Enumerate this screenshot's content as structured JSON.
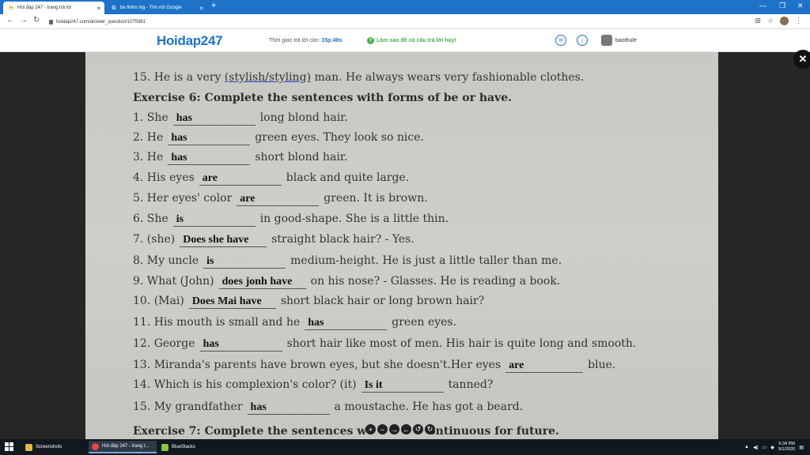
{
  "browser": {
    "tabs": [
      {
        "label": "Hỏi đáp 247 - trang trả lời",
        "active": true
      },
      {
        "label": "be thêm ing - Tìm với Google",
        "active": false
      }
    ],
    "url": "hoidap247.com/answer_question/1075981"
  },
  "site": {
    "logo": "Hoidap247",
    "timer_label": "Thời gian trả lời còn:",
    "timer_value": "15p:48s",
    "howto": "Làm sao để có câu trả lời hay!",
    "username": "baothule"
  },
  "worksheet": {
    "line15": {
      "pre": "15. He is a very ",
      "choice": "(stylish/styling)",
      "post": " man. He always wears very fashionable clothes."
    },
    "title6": "Exercise 6: Complete the sentences with forms of be or have.",
    "items": [
      {
        "pre": "1.  She",
        "answer": "has",
        "post": "long blond hair."
      },
      {
        "pre": "2.  He",
        "answer": "has",
        "post": "green eyes. They look so nice."
      },
      {
        "pre": "3.  He",
        "answer": "has",
        "post": "short blond hair."
      },
      {
        "pre": "4.  His eyes",
        "answer": "are",
        "post": "black and quite large."
      },
      {
        "pre": "5.  Her eyes' color",
        "answer": "are",
        "post": "green. It is brown."
      },
      {
        "pre": "6.  She",
        "answer": "is",
        "post": "in good-shape. She is a little thin."
      },
      {
        "pre": "7.  (she)",
        "answer": "Does she have",
        "post": "straight black hair? - Yes."
      },
      {
        "pre": "8.  My uncle",
        "answer": "is",
        "post": "medium-height. He is just a little taller than me."
      },
      {
        "pre": "9.  What (John)",
        "answer": "does jonh have",
        "post": "on his nose? - Glasses. He is reading a book."
      },
      {
        "pre": "10. (Mai)",
        "answer": "Does Mai have",
        "post": "short black hair or long brown hair?"
      },
      {
        "pre": "11. His mouth is small and he",
        "answer": "has",
        "post": "green eyes."
      },
      {
        "pre": "12. George",
        "answer": "has",
        "post": "short hair like most of men. His hair is quite long and smooth."
      },
      {
        "pre": "13. Miranda's parents have brown eyes, but she doesn't.Her eyes",
        "answer": "are",
        "post": "blue."
      },
      {
        "pre": "14. Which is his complexion's color? (it)",
        "answer": "Is it",
        "post": "tanned?"
      },
      {
        "pre": "15. My grandfather",
        "answer": "has",
        "post": "a moustache. He has got a beard."
      }
    ],
    "title7_pre": "Exercise 7: Complete the sentences w",
    "title7_post": "ontinuous for future."
  },
  "taskbar": {
    "items": [
      "Screenshots",
      "Hỏi đáp 247 - trang t...",
      "BlueStacks"
    ],
    "time": "6:34 PM",
    "date": "9/1/2020"
  },
  "colors": {
    "brand": "#1e73c8",
    "tabstrip": "#1e73c8",
    "howto": "#4caf50"
  }
}
